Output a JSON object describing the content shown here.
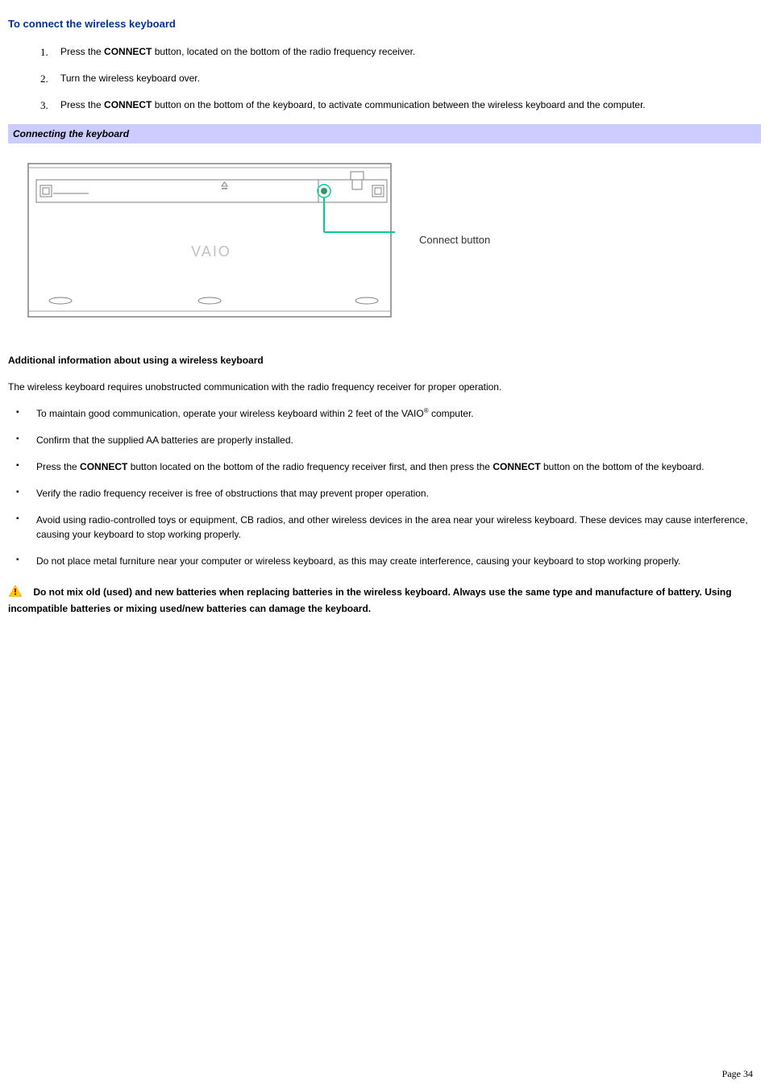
{
  "heading": "To connect the wireless keyboard",
  "steps": [
    {
      "num": "1.",
      "pre": "Press the ",
      "bold": "CONNECT",
      "post": " button, located on the bottom of the radio frequency receiver."
    },
    {
      "num": "2.",
      "pre": "Turn the wireless keyboard over.",
      "bold": "",
      "post": ""
    },
    {
      "num": "3.",
      "pre": "Press the ",
      "bold": "CONNECT",
      "post": " button on the bottom of the keyboard, to activate communication between the wireless keyboard and the computer."
    }
  ],
  "figure_caption": "Connecting the keyboard",
  "figure_label": "Connect button",
  "figure_logo": "VAIO",
  "subheading": "Additional information about using a wireless keyboard",
  "intro_text": "The wireless keyboard requires unobstructed communication with the radio frequency receiver for proper operation.",
  "bullets": [
    {
      "pre": "To maintain good communication, operate your wireless keyboard within 2 feet of the VAIO",
      "reg": "®",
      "post": " computer."
    },
    {
      "pre": "Confirm that the supplied AA batteries are properly installed.",
      "reg": "",
      "post": ""
    },
    {
      "pre": "Press the ",
      "bold1": "CONNECT",
      "mid": " button located on the bottom of the radio frequency receiver first, and then press the ",
      "bold2": "CONNECT",
      "post2": " button on the bottom of the keyboard."
    },
    {
      "pre": "Verify the radio frequency receiver is free of obstructions that may prevent proper operation.",
      "reg": "",
      "post": ""
    },
    {
      "pre": "Avoid using radio-controlled toys or equipment, CB radios, and other wireless devices in the area near your wireless keyboard. These devices may cause interference, causing your keyboard to stop working properly.",
      "reg": "",
      "post": ""
    },
    {
      "pre": "Do not place metal furniture near your computer or wireless keyboard, as this may create interference, causing your keyboard to stop working properly.",
      "reg": "",
      "post": ""
    }
  ],
  "warning_text": "Do not mix old (used) and new batteries when replacing batteries in the wireless keyboard. Always use the same type and manufacture of battery. Using incompatible batteries or mixing used/new batteries can damage the keyboard.",
  "page_number": "Page 34"
}
